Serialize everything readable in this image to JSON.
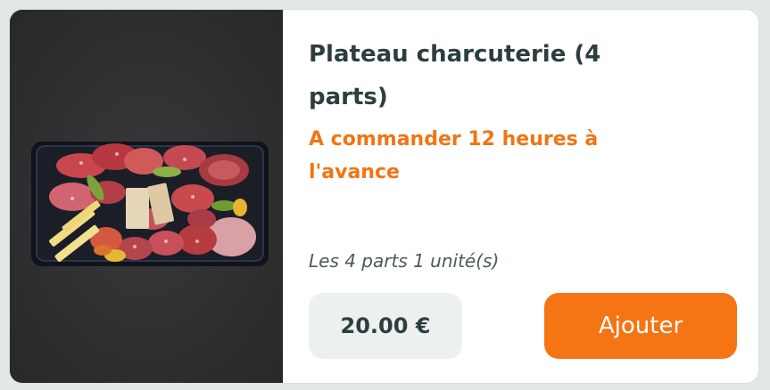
{
  "product": {
    "title": "Plateau charcuterie (4 parts)",
    "notice": "A commander 12 heures à l'avance",
    "unit": "Les 4 parts 1 unité(s)",
    "price": "20.00 €",
    "add_label": "Ajouter",
    "image_subject": "charcuterie platter with salami slices, ham, peppers and cheese on a black tray"
  },
  "colors": {
    "accent": "#f57413",
    "notice": "#f07514",
    "title": "#2c3e3f",
    "price_bg": "#ecf1f0"
  }
}
